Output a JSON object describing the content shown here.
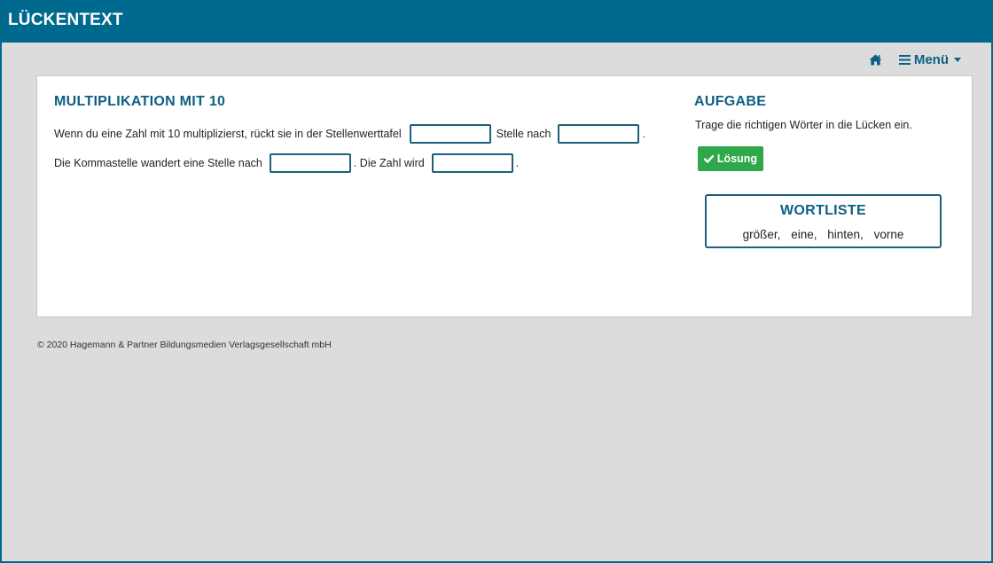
{
  "header": {
    "title": "LÜCKENTEXT"
  },
  "nav": {
    "home_icon": "home-icon",
    "menu_label": "Menü"
  },
  "task": {
    "title": "MULTIPLIKATION MIT 10",
    "line1_part1": "Wenn du eine Zahl mit 10 multiplizierst, rückt sie in der Stellenwerttafel",
    "line1_part2": "Stelle nach",
    "line1_end": ".",
    "line2_part1": "Die Kommastelle wandert eine Stelle nach",
    "line2_part2": ". Die Zahl wird",
    "line2_end": ".",
    "gaps": [
      "",
      "",
      "",
      ""
    ]
  },
  "aside": {
    "title": "AUFGABE",
    "instruction": "Trage die richtigen Wörter in die Lücken ein.",
    "solution_button": "Lösung",
    "solution_icon": "check-icon"
  },
  "wordlist": {
    "title": "WORTLISTE",
    "words": [
      "größer,",
      "eine,",
      "hinten,",
      "vorne"
    ]
  },
  "footer": {
    "copyright": "© 2020 Hagemann & Partner Bildungsmedien Verlagsgesellschaft mbH"
  },
  "colors": {
    "brand": "#00698e",
    "accent_text": "#0d5f82",
    "success": "#2ea84a",
    "background": "#dcdcdc"
  }
}
